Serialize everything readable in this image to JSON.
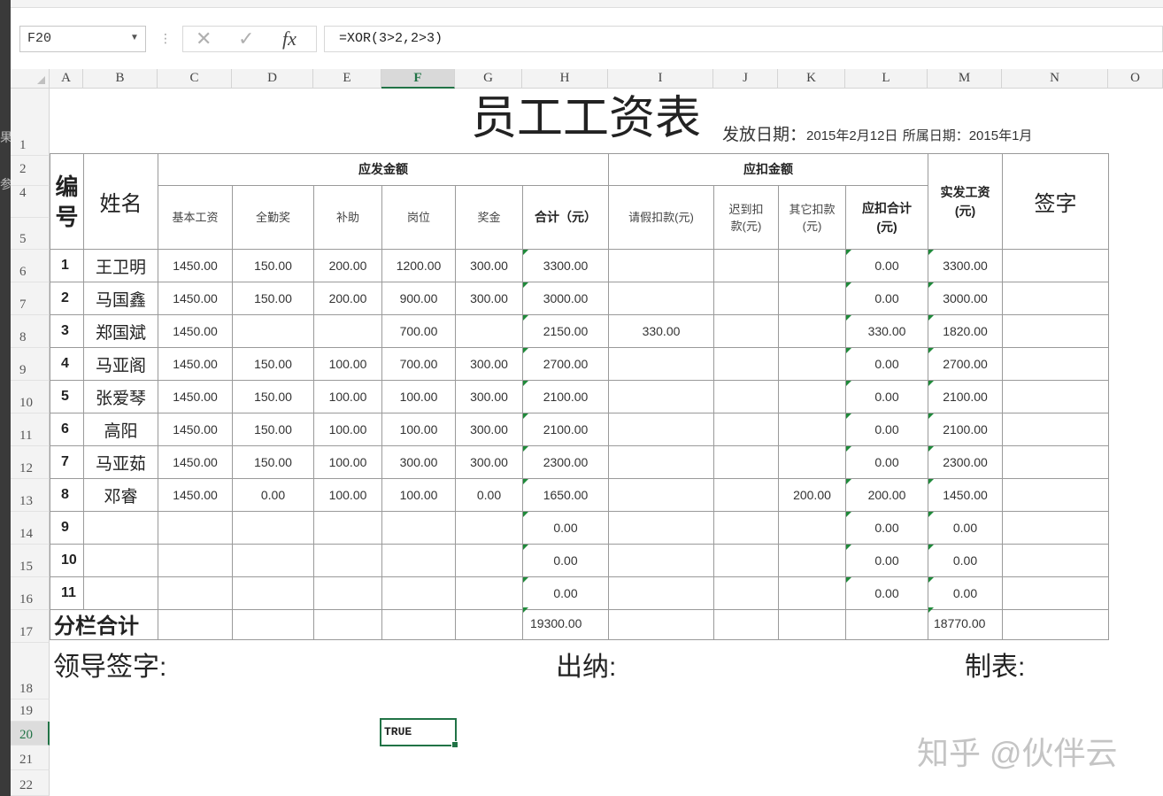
{
  "formula_bar": {
    "name_box": "F20",
    "cancel_icon": "✕",
    "confirm_icon": "✓",
    "fx_label": "fx",
    "formula": "=XOR(3>2,2>3)"
  },
  "columns": [
    "A",
    "B",
    "C",
    "D",
    "E",
    "F",
    "G",
    "H",
    "I",
    "J",
    "K",
    "L",
    "M",
    "N",
    "O"
  ],
  "rows": [
    "1",
    "2",
    "4",
    "5",
    "6",
    "7",
    "8",
    "9",
    "10",
    "11",
    "12",
    "13",
    "14",
    "15",
    "16",
    "17",
    "18",
    "19",
    "20",
    "21",
    "22"
  ],
  "selected_column": "F",
  "selected_row": "20",
  "sheet": {
    "title": "员工工资表",
    "issue_date_label": "发放日期：",
    "issue_date": "2015年2月12日",
    "period_label": "所属日期：",
    "period": "2015年1月",
    "headers": {
      "no": "编号",
      "name": "姓名",
      "gross_group": "应发金额",
      "deduct_group": "应扣金额",
      "net_pay": "实发工资\n(元)",
      "signature": "签字",
      "base_salary": "基本工资",
      "attendance_bonus": "全勤奖",
      "allowance": "补助",
      "position": "岗位",
      "bonus": "奖金",
      "gross_total": "合计（元）",
      "leave_deduct": "请假扣款(元)",
      "late_deduct": "迟到扣\n款(元)",
      "other_deduct": "其它扣款\n(元)",
      "deduct_total": "应扣合计\n(元)"
    },
    "records": [
      {
        "no": "1",
        "name": "王卫明",
        "base": "1450.00",
        "att": "150.00",
        "allow": "200.00",
        "pos": "1200.00",
        "bonus": "300.00",
        "total": "3300.00",
        "leave": "",
        "late": "",
        "other": "",
        "dtotal": "0.00",
        "net": "3300.00"
      },
      {
        "no": "2",
        "name": "马国鑫",
        "base": "1450.00",
        "att": "150.00",
        "allow": "200.00",
        "pos": "900.00",
        "bonus": "300.00",
        "total": "3000.00",
        "leave": "",
        "late": "",
        "other": "",
        "dtotal": "0.00",
        "net": "3000.00"
      },
      {
        "no": "3",
        "name": "郑国斌",
        "base": "1450.00",
        "att": "",
        "allow": "",
        "pos": "700.00",
        "bonus": "",
        "total": "2150.00",
        "leave": "330.00",
        "late": "",
        "other": "",
        "dtotal": "330.00",
        "net": "1820.00"
      },
      {
        "no": "4",
        "name": "马亚阁",
        "base": "1450.00",
        "att": "150.00",
        "allow": "100.00",
        "pos": "700.00",
        "bonus": "300.00",
        "total": "2700.00",
        "leave": "",
        "late": "",
        "other": "",
        "dtotal": "0.00",
        "net": "2700.00"
      },
      {
        "no": "5",
        "name": "张爱琴",
        "base": "1450.00",
        "att": "150.00",
        "allow": "100.00",
        "pos": "100.00",
        "bonus": "300.00",
        "total": "2100.00",
        "leave": "",
        "late": "",
        "other": "",
        "dtotal": "0.00",
        "net": "2100.00"
      },
      {
        "no": "6",
        "name": "高阳",
        "base": "1450.00",
        "att": "150.00",
        "allow": "100.00",
        "pos": "100.00",
        "bonus": "300.00",
        "total": "2100.00",
        "leave": "",
        "late": "",
        "other": "",
        "dtotal": "0.00",
        "net": "2100.00"
      },
      {
        "no": "7",
        "name": "马亚茹",
        "base": "1450.00",
        "att": "150.00",
        "allow": "100.00",
        "pos": "300.00",
        "bonus": "300.00",
        "total": "2300.00",
        "leave": "",
        "late": "",
        "other": "",
        "dtotal": "0.00",
        "net": "2300.00"
      },
      {
        "no": "8",
        "name": "邓睿",
        "base": "1450.00",
        "att": "0.00",
        "allow": "100.00",
        "pos": "100.00",
        "bonus": "0.00",
        "total": "1650.00",
        "leave": "",
        "late": "",
        "other": "200.00",
        "dtotal": "200.00",
        "net": "1450.00"
      },
      {
        "no": "9",
        "name": "",
        "base": "",
        "att": "",
        "allow": "",
        "pos": "",
        "bonus": "",
        "total": "0.00",
        "leave": "",
        "late": "",
        "other": "",
        "dtotal": "0.00",
        "net": "0.00"
      },
      {
        "no": "10",
        "name": "",
        "base": "",
        "att": "",
        "allow": "",
        "pos": "",
        "bonus": "",
        "total": "0.00",
        "leave": "",
        "late": "",
        "other": "",
        "dtotal": "0.00",
        "net": "0.00"
      },
      {
        "no": "11",
        "name": "",
        "base": "",
        "att": "",
        "allow": "",
        "pos": "",
        "bonus": "",
        "total": "0.00",
        "leave": "",
        "late": "",
        "other": "",
        "dtotal": "0.00",
        "net": "0.00"
      }
    ],
    "subtotal_label": "分栏合计",
    "subtotal_gross": "19300.00",
    "subtotal_net": "18770.00",
    "leader_sign": "领导签字:",
    "cashier": "出纳:",
    "prepared_by": "制表:",
    "result_cell": "TRUE"
  },
  "watermark": "知乎 @伙伴云"
}
